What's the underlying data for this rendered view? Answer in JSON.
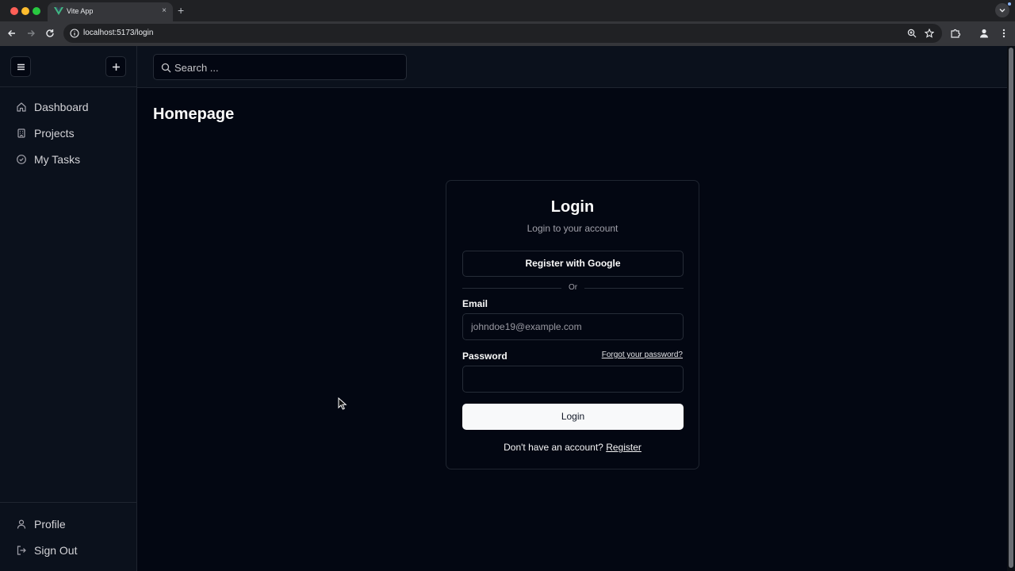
{
  "browser": {
    "tab_title": "Vite App",
    "tab_close": "×",
    "new_tab": "+",
    "url": "localhost:5173/login"
  },
  "sidebar": {
    "nav_items": [
      {
        "label": "Dashboard",
        "icon": "home-icon"
      },
      {
        "label": "Projects",
        "icon": "building-icon"
      },
      {
        "label": "My Tasks",
        "icon": "check-circle-icon"
      }
    ],
    "bottom_items": [
      {
        "label": "Profile",
        "icon": "user-icon"
      },
      {
        "label": "Sign Out",
        "icon": "logout-icon"
      }
    ]
  },
  "topbar": {
    "search_placeholder": "Search ..."
  },
  "main": {
    "title": "Homepage"
  },
  "login": {
    "title": "Login",
    "subtitle": "Login to your account",
    "google_button": "Register with Google",
    "divider": "Or",
    "email_label": "Email",
    "email_placeholder": "johndoe19@example.com",
    "password_label": "Password",
    "password_value": "",
    "forgot_link": "Forgot your password?",
    "submit_button": "Login",
    "register_prompt": "Don't have an account?",
    "register_link": "Register"
  },
  "colors": {
    "page_bg": "#030712",
    "sidebar_bg": "#0b111c",
    "border": "#1f2530",
    "primary_button": "#f8f9fa",
    "vite_green": "#41b883"
  }
}
